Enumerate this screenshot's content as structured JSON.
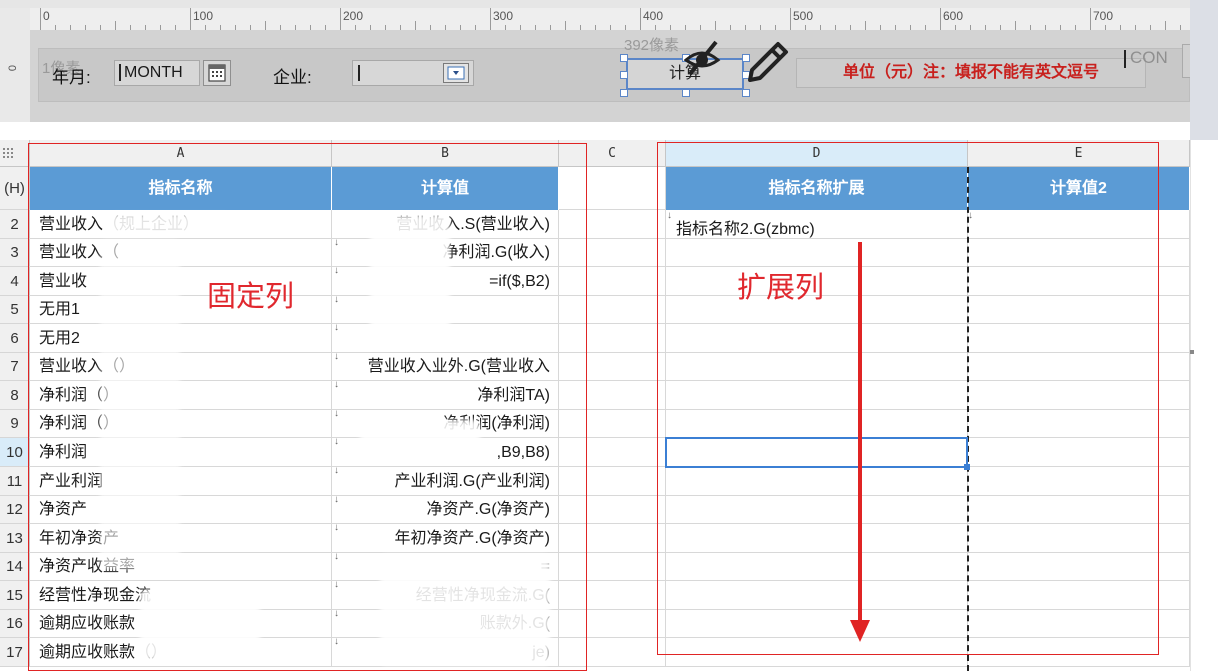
{
  "ruler": {
    "corner": "0",
    "marks": [
      "0",
      "100",
      "200",
      "300",
      "400",
      "500",
      "600",
      "700"
    ]
  },
  "form": {
    "ghost_text_left": "1像素",
    "ghost_text_calc": "392像素",
    "year_month_label": "年月:",
    "year_month_value": "MONTH",
    "company_label": "企业:",
    "calc_button_label": "计算",
    "unit_note": "单位（元）注：填报不能有英文逗号",
    "con_label": "CON"
  },
  "sheet": {
    "corner_icon": "grid-dots",
    "columns": [
      "A",
      "B",
      "C",
      "D",
      "E"
    ],
    "header_row_label": "(H)",
    "header": {
      "A": "指标名称",
      "B": "计算值",
      "D": "指标名称扩展",
      "E": "计算值2"
    },
    "rows": [
      {
        "num": "2",
        "a": "营业收入（规上企业）",
        "b": "营业收入.S(营业收入)"
      },
      {
        "num": "3",
        "a": "营业收入（",
        "b": "净利润.G(收入)"
      },
      {
        "num": "4",
        "a": "营业收",
        "b": "=if($,B2)"
      },
      {
        "num": "5",
        "a": "无用1",
        "b": ""
      },
      {
        "num": "6",
        "a": "无用2",
        "b": ""
      },
      {
        "num": "7",
        "a": "营业收入（）",
        "b": "营业收入业外.G(营业收入"
      },
      {
        "num": "8",
        "a": "净利润（）",
        "b": "净利润TA)"
      },
      {
        "num": "9",
        "a": "净利润（）",
        "b": "净利润(净利润)"
      },
      {
        "num": "10",
        "a": "净利润",
        "b": ",B9,B8)"
      },
      {
        "num": "11",
        "a": "产业利润",
        "b": "产业利润.G(产业利润)"
      },
      {
        "num": "12",
        "a": "净资产",
        "b": "净资产.G(净资产)"
      },
      {
        "num": "13",
        "a": "年初净资产",
        "b": "年初净资产.G(净资产)"
      },
      {
        "num": "14",
        "a": "净资产收益率",
        "b": "="
      },
      {
        "num": "15",
        "a": "经营性净现金流",
        "b": "经营性净现金流.G("
      },
      {
        "num": "16",
        "a": "逾期应收账款",
        "b": "账款外.G("
      },
      {
        "num": "17",
        "a": "逾期应收账款（）",
        "b": "je)"
      }
    ],
    "d_first_value": "指标名称2.G(zbmc)",
    "selected_row": "10"
  },
  "annotations": {
    "fixed_column": "固定列",
    "expand_column": "扩展列"
  },
  "colors": {
    "header_blue": "#5b9bd5",
    "annotation_red": "#e0282e",
    "selection_blue": "#3b7fd4"
  }
}
